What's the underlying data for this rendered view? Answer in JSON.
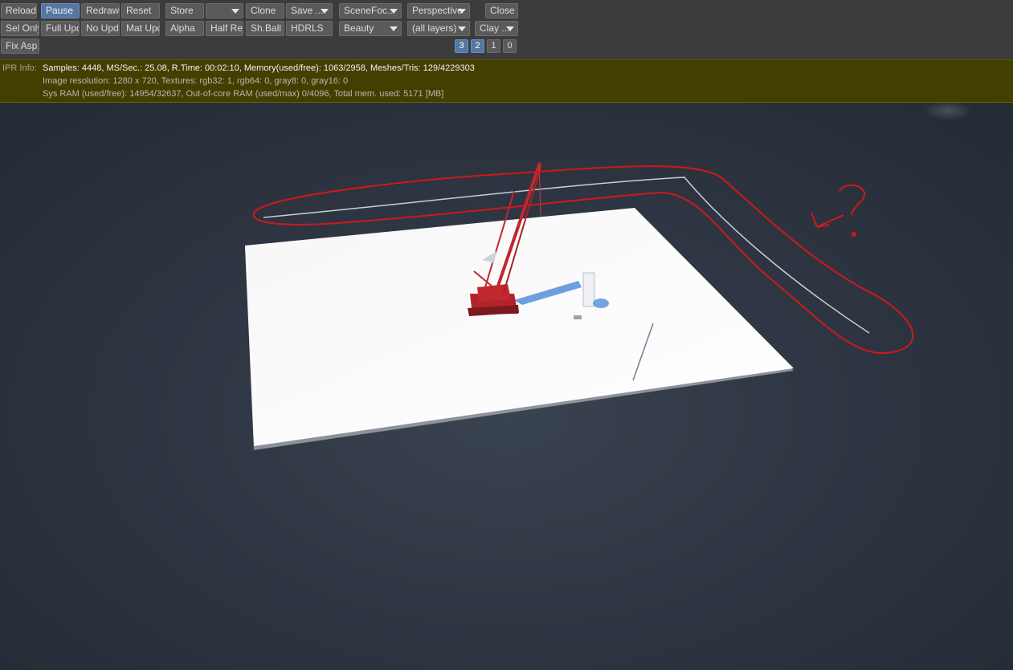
{
  "toolbar": {
    "row1": {
      "reload": "Reload",
      "pause": "Pause",
      "redraw": "Redraw",
      "reset": "Reset",
      "store": "Store",
      "store_slot": "",
      "clone": "Clone",
      "save": "Save ...",
      "scene_focus": "SceneFoc...",
      "perspective": "Perspective",
      "close": "Close"
    },
    "row2": {
      "sel_only": "Sel Only",
      "full_upd": "Full Upd.",
      "no_upd": "No Upd.",
      "mat_upd": "Mat Upd",
      "alpha": "Alpha",
      "half_res": "Half Res",
      "sh_ball": "Sh.Ball",
      "hdrls": "HDRLS",
      "beauty": "Beauty",
      "layers": "(all layers)",
      "clay": "Clay ..."
    },
    "row3": {
      "fix_asp": "Fix Asp.",
      "page_buttons": [
        "3",
        "2",
        "1",
        "0"
      ]
    }
  },
  "info": {
    "label": "IPR Info:",
    "line1": "Samples: 4448, MS/Sec.: 25.08, R.Time: 00:02:10, Memory(used/free): 1063/2958, Meshes/Tris: 129/4229303",
    "line2": "Image resolution: 1280 x 720, Textures:  rgb32: 1, rgb64: 0, gray8: 0, gray16: 0",
    "line3": "Sys RAM (used/free): 14954/32637, Out-of-core RAM (used/max) 0/4096, Total mem. used: 5171  [MB]"
  },
  "annotation": {
    "mark": "?",
    "color": "#d01818"
  },
  "colors": {
    "active": "#5577a3",
    "info_bg": "#433f00",
    "crane": "#c0282e"
  }
}
